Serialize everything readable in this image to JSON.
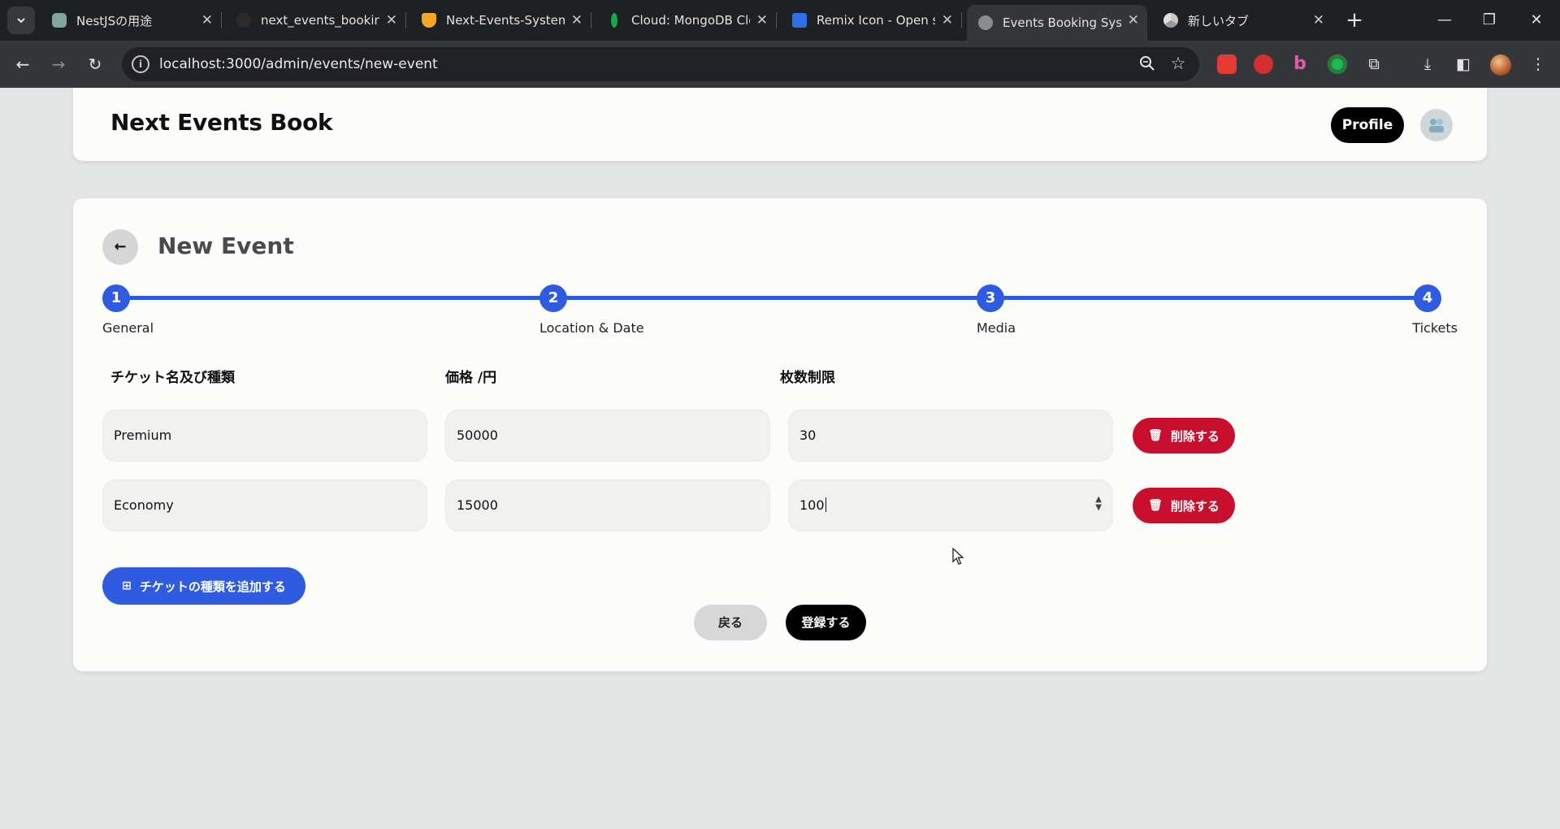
{
  "browser": {
    "tabs": [
      {
        "title": "NestJSの用途",
        "favicon_color": "#7fa89a"
      },
      {
        "title": "next_events_booking",
        "favicon_color": "#2b2b2b"
      },
      {
        "title": "Next-Events-System",
        "favicon_color": "#f5a623"
      },
      {
        "title": "Cloud: MongoDB Clo",
        "favicon_color": "#13aa52"
      },
      {
        "title": "Remix Icon - Open so",
        "favicon_color": "#2f6fe8"
      },
      {
        "title": "Events Booking Syste",
        "favicon_color": "#8a8c90"
      },
      {
        "title": "新しいタブ",
        "favicon_color": "#c9c9c9"
      }
    ],
    "active_tab_index": 5,
    "address": "localhost:3000/admin/events/new-event"
  },
  "header": {
    "brand": "Next Events Book",
    "profile_label": "Profile"
  },
  "page": {
    "title": "New Event",
    "steps": [
      {
        "number": "1",
        "label": "General"
      },
      {
        "number": "2",
        "label": "Location & Date"
      },
      {
        "number": "3",
        "label": "Media"
      },
      {
        "number": "4",
        "label": "Tickets"
      }
    ],
    "columns": {
      "name": "チケット名及び種類",
      "price": "価格 /円",
      "limit": "枚数制限"
    },
    "tickets": [
      {
        "name": "Premium",
        "price": "50000",
        "limit": "30",
        "delete_label": "削除する"
      },
      {
        "name": "Economy",
        "price": "15000",
        "limit": "100",
        "delete_label": "削除する"
      }
    ],
    "add_label": "チケットの種類を追加する",
    "back_label": "戻る",
    "submit_label": "登録する"
  },
  "colors": {
    "primary": "#2f5be0",
    "danger": "#c8102e",
    "black": "#000000"
  }
}
